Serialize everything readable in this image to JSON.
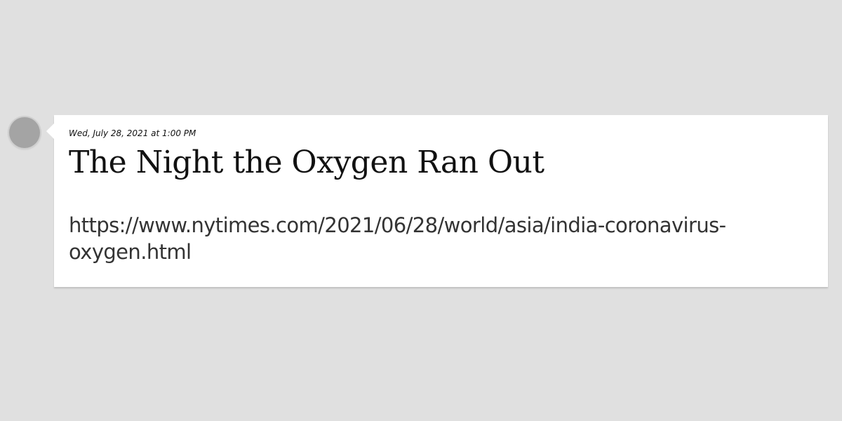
{
  "post": {
    "date": "Wed, July 28, 2021 at 1:00 PM",
    "title": "The Night the Oxygen Ran Out",
    "link_line1": "https://www.nytimes.com/2021/06/28/world/asia/india-coronavirus-",
    "link_line2": "oxygen.html"
  },
  "colors": {
    "background": "#e0e0e0",
    "card": "#ffffff",
    "dot": "#a4a4a4",
    "title_text": "#111111",
    "link_text": "#333333"
  }
}
